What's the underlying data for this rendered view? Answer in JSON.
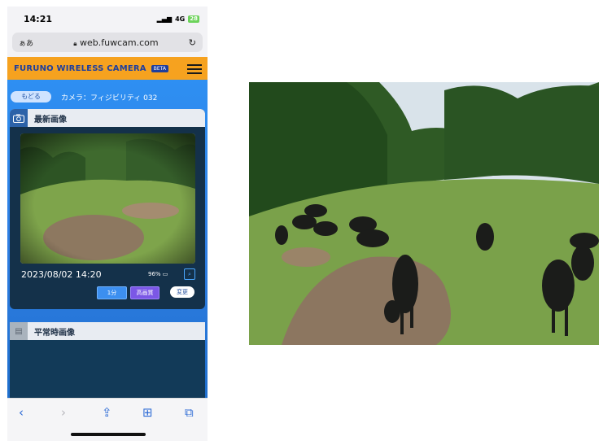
{
  "status": {
    "time": "14:21",
    "network": "4G",
    "battery": "28"
  },
  "browser": {
    "text_size": "ぁあ",
    "url": "web.fuwcam.com"
  },
  "app": {
    "brand": "FURUNO WIRELESS CAMERA",
    "beta": "BETA",
    "back_label": "もどる",
    "camera_name": "カメラ：フィジビリティ 032"
  },
  "latest": {
    "title": "最新画像",
    "timestamp": "2023/08/02 14:20",
    "battery_pct": "96%",
    "interval_label": "1分",
    "quality_label": "高画質",
    "change_label": "変更"
  },
  "normal": {
    "title": "平常時画像"
  },
  "colors": {
    "header": "#f6a21f",
    "brand_text": "#1f3f9d",
    "accent": "#2e8ff2"
  },
  "icons": [
    "signal-icon",
    "lock-icon",
    "reload-icon",
    "menu-icon",
    "camera-icon",
    "battery-icon",
    "zoom-icon",
    "back-icon",
    "forward-icon",
    "share-icon",
    "bookmarks-icon",
    "tabs-icon"
  ]
}
